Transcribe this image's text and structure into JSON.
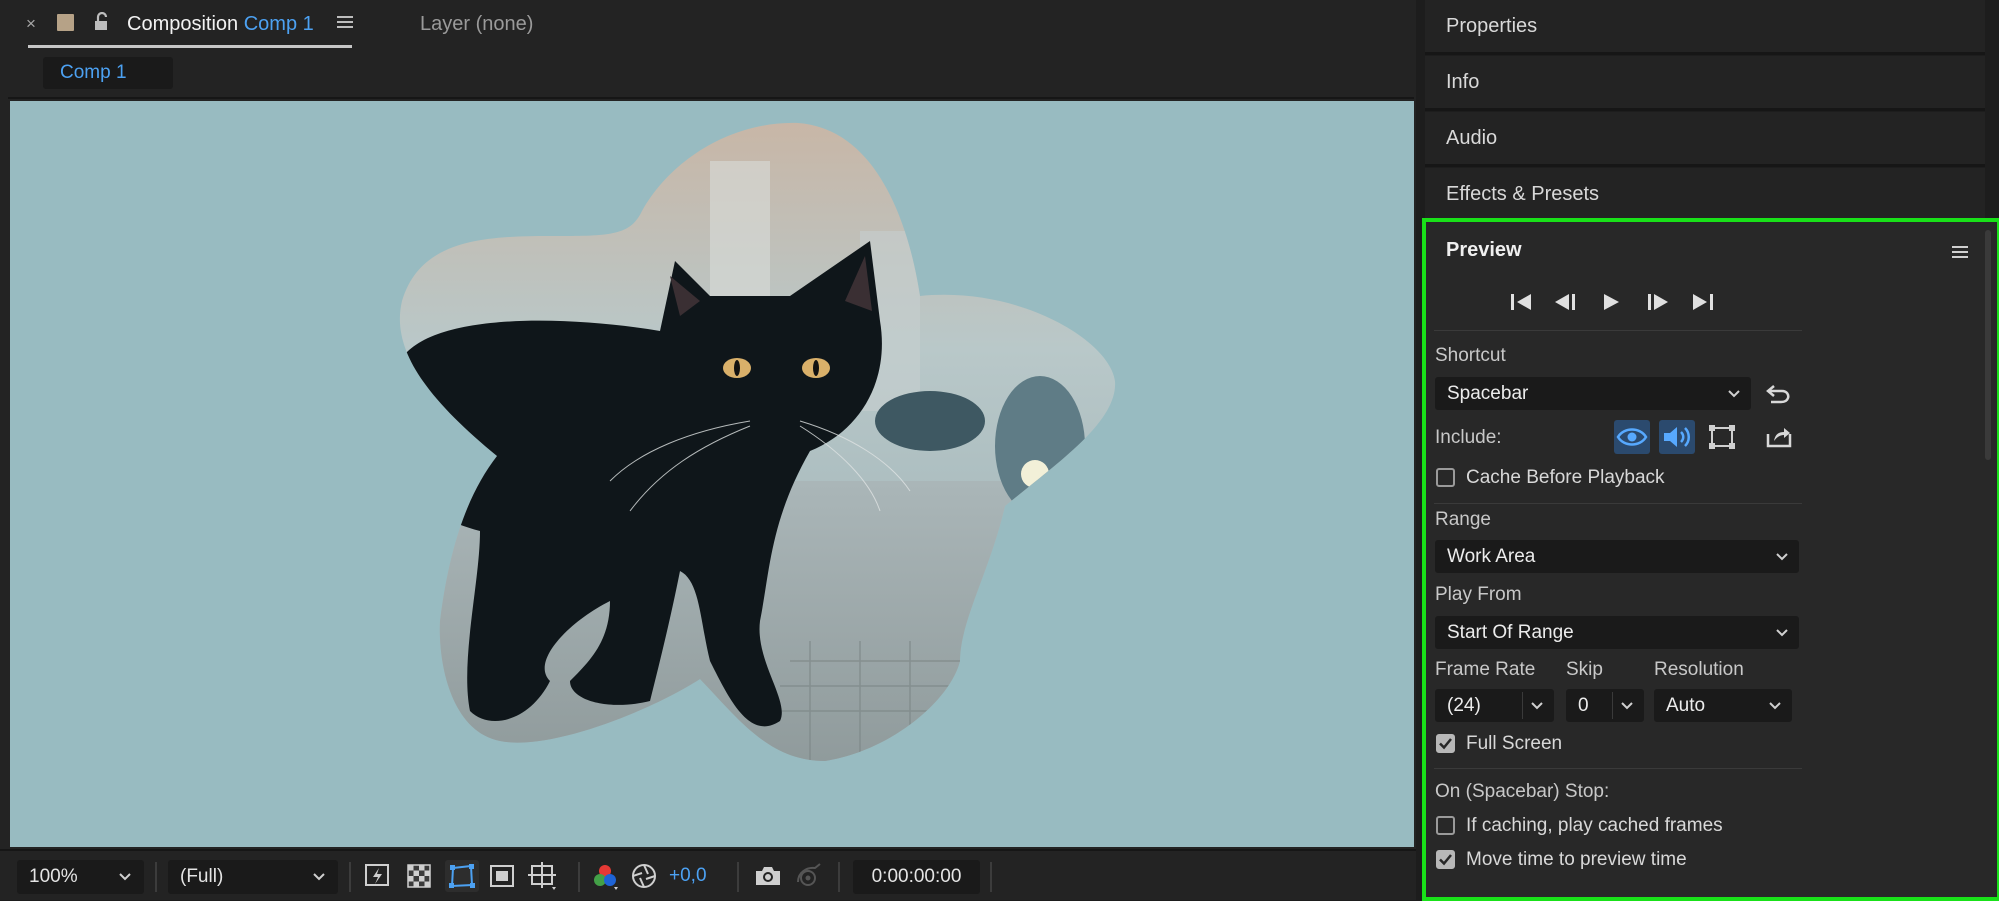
{
  "composition_panel": {
    "tab_title_prefix": "Composition",
    "tab_title_comp": "Comp 1",
    "layer_tab": "Layer (none)",
    "comp_chip": "Comp 1",
    "toolbar": {
      "zoom": "100%",
      "resolution": "(Full)",
      "exposure": "+0,0",
      "timecode": "0:00:00:00"
    }
  },
  "right_panels": {
    "properties": "Properties",
    "info": "Info",
    "audio": "Audio",
    "effects_presets": "Effects & Presets"
  },
  "preview": {
    "title": "Preview",
    "shortcut_label": "Shortcut",
    "shortcut_value": "Spacebar",
    "include_label": "Include:",
    "include_video_on": true,
    "include_audio_on": true,
    "include_overlays_on": false,
    "cache_before_playback": {
      "label": "Cache Before Playback",
      "checked": false
    },
    "range_label": "Range",
    "range_value": "Work Area",
    "play_from_label": "Play From",
    "play_from_value": "Start Of Range",
    "frame_rate_label": "Frame Rate",
    "frame_rate_value": "(24)",
    "skip_label": "Skip",
    "skip_value": "0",
    "resolution_label": "Resolution",
    "resolution_value": "Auto",
    "full_screen": {
      "label": "Full Screen",
      "checked": true
    },
    "stop_label": "On (Spacebar) Stop:",
    "if_caching": {
      "label": "If caching, play cached frames",
      "checked": false
    },
    "move_time": {
      "label": "Move time to preview time",
      "checked": true
    }
  },
  "colors": {
    "accent_blue": "#4ca1f2",
    "highlight_green": "#19e119",
    "viewer_bg": "#98bbc1"
  }
}
